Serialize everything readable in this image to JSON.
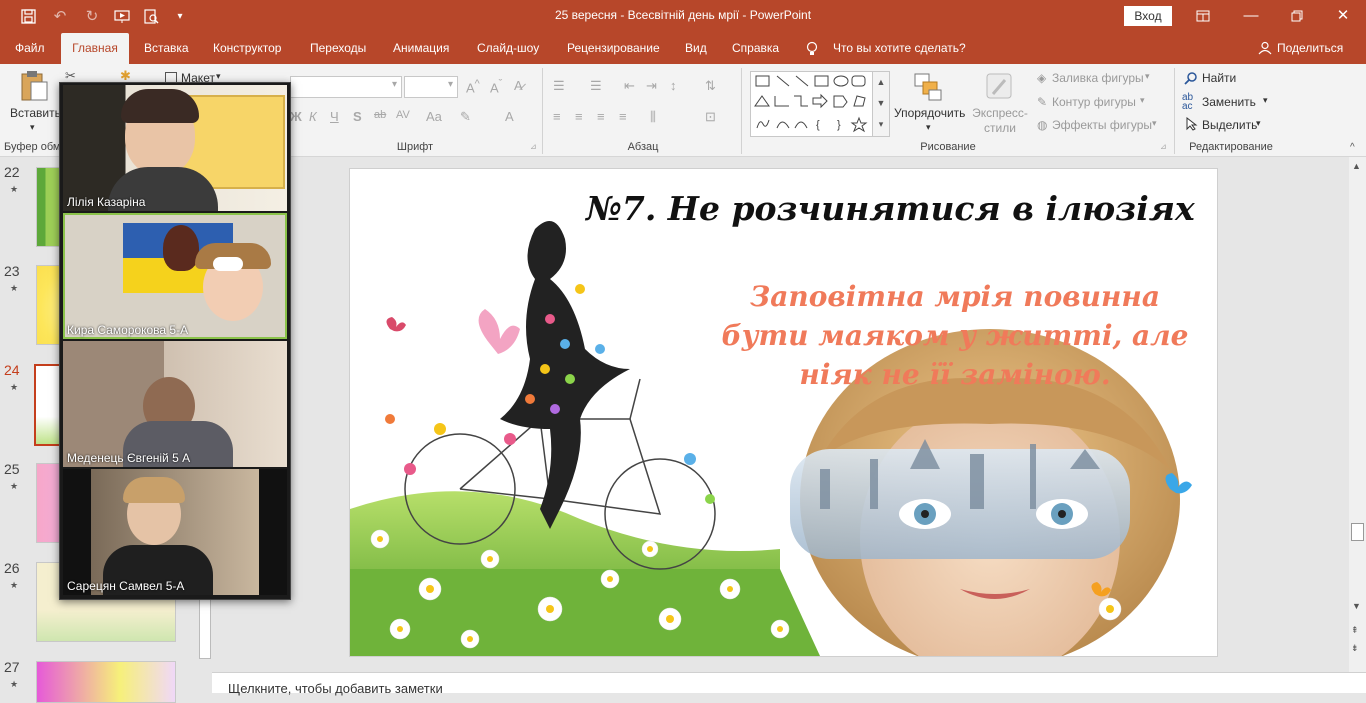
{
  "titlebar": {
    "doc_title": "25 вересня - Всесвітній день мрії  -  PowerPoint",
    "signin_label": "Вход",
    "accent": "#b7472a"
  },
  "menu": {
    "tabs": [
      "Файл",
      "Главная",
      "Вставка",
      "Конструктор",
      "Переходы",
      "Анимация",
      "Слайд-шоу",
      "Рецензирование",
      "Вид",
      "Справка"
    ],
    "active_tab": "Главная",
    "tell_me": "Что вы хотите сделать?",
    "share": "Поделиться"
  },
  "ribbon": {
    "paste_label": "Вставить",
    "layout_label": "Макет",
    "clipboard_group": "Буфер обм",
    "font_group": "Шрифт",
    "paragraph_group": "Абзац",
    "drawing_group": "Рисование",
    "editing_group": "Редактирование",
    "arrange_label": "Упорядочить",
    "quick_styles_label": "Экспресс-стили",
    "shape_fill": "Заливка фигуры",
    "shape_outline": "Контур фигуры",
    "shape_effects": "Эффекты фигуры",
    "find": "Найти",
    "replace": "Заменить",
    "select": "Выделить",
    "font_buttons": [
      "Ж",
      "К",
      "Ч",
      "S",
      "ab",
      "AV",
      "Aa",
      "A"
    ]
  },
  "thumbnails": [
    {
      "num": "22",
      "star": "★"
    },
    {
      "num": "23",
      "star": "★"
    },
    {
      "num": "24",
      "star": "★",
      "selected": true
    },
    {
      "num": "25",
      "star": "★"
    },
    {
      "num": "26",
      "star": "★"
    },
    {
      "num": "27",
      "star": "★"
    }
  ],
  "slide": {
    "title": "№7. Не розчинятися в ілюзіях",
    "quote_line1": "Заповітна мрія повинна",
    "quote_line2": "бути маяком у житті, але",
    "quote_line3": "ніяк не її заміною.",
    "quote_color": "#f07a5a"
  },
  "notes": {
    "placeholder": "Щелкните, чтобы добавить заметки"
  },
  "participants": [
    {
      "name": "Лілія Казаріна"
    },
    {
      "name": "Кира Саморокова 5-А"
    },
    {
      "name": "Меденець Євгеній 5 А"
    },
    {
      "name": "Сарецян Самвел 5-А"
    }
  ]
}
